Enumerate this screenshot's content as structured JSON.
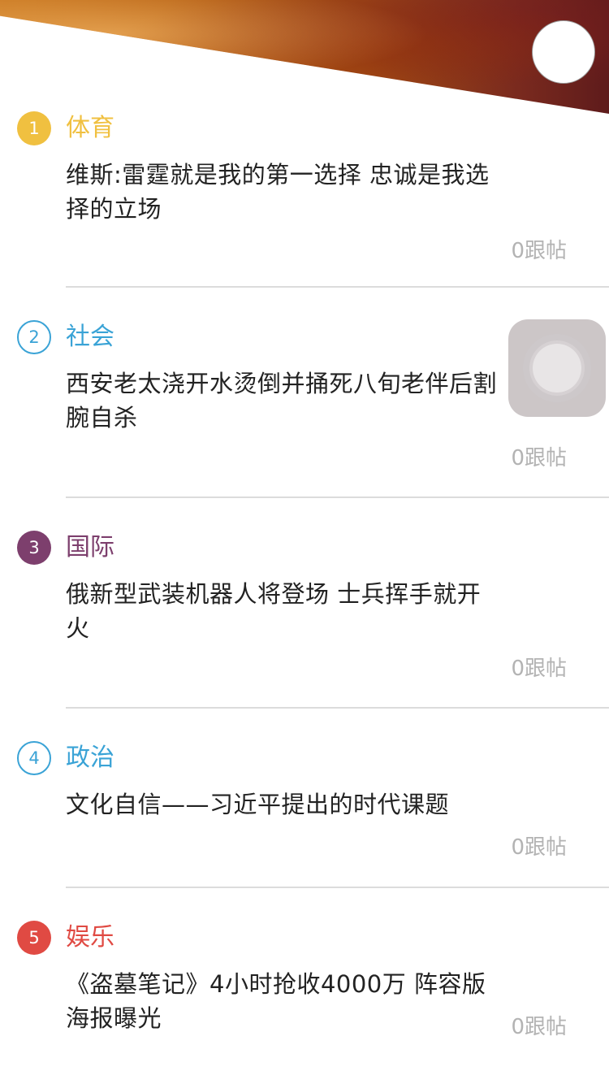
{
  "header": {
    "banner": "header-banner"
  },
  "items": [
    {
      "rank": "1",
      "category": "体育",
      "color": "#f0c040",
      "filled": true,
      "headline_line1": "维斯:雷霆就是我的第一选择 忠诚是我选",
      "headline_line2": "择的立场",
      "comments": "0跟帖"
    },
    {
      "rank": "2",
      "category": "社会",
      "color": "#3aa3d6",
      "filled": false,
      "headline_line1": "西安老太浇开水烫倒并捅死八旬老伴后割",
      "headline_line2": "腕自杀",
      "comments": "0跟帖"
    },
    {
      "rank": "3",
      "category": "国际",
      "color": "#7d3f6d",
      "filled": true,
      "headline_line1": "俄新型武装机器人将登场 士兵挥手就开",
      "headline_line2": "火",
      "comments": "0跟帖"
    },
    {
      "rank": "4",
      "category": "政治",
      "color": "#3aa3d6",
      "filled": false,
      "headline_line1": "文化自信——习近平提出的时代课题",
      "headline_line2": "",
      "comments": "0跟帖"
    },
    {
      "rank": "5",
      "category": "娱乐",
      "color": "#e04a43",
      "filled": true,
      "headline_line1": "《盗墓笔记》4小时抢收4000万 阵容版",
      "headline_line2": "海报曝光",
      "comments": "0跟帖"
    }
  ]
}
